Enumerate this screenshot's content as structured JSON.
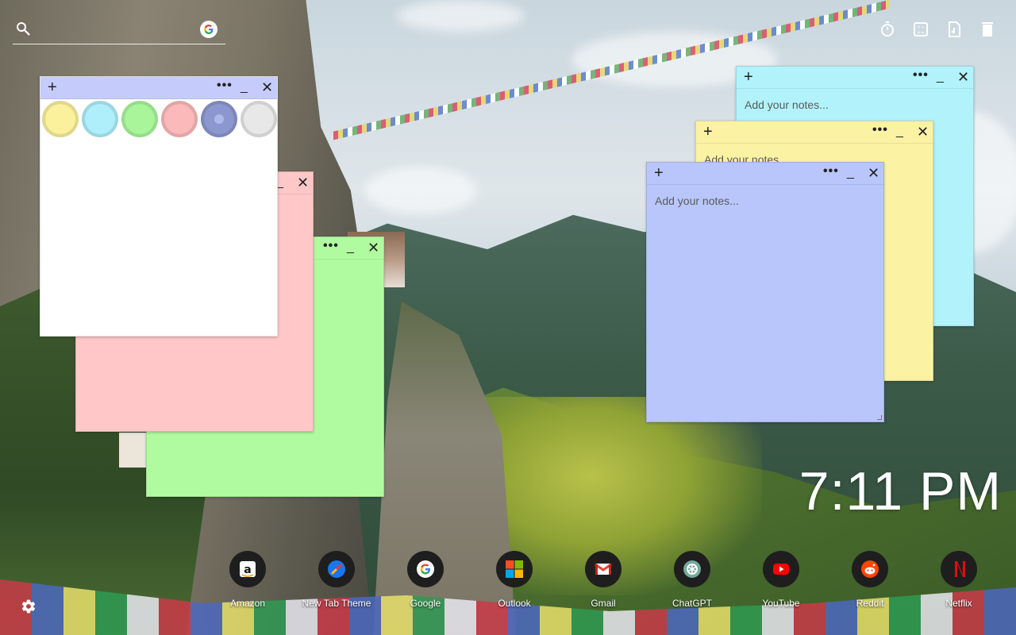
{
  "search": {
    "placeholder": ""
  },
  "top_icons": [
    {
      "name": "timer-icon"
    },
    {
      "name": "calculator-icon"
    },
    {
      "name": "notes-icon"
    },
    {
      "name": "trash-icon"
    }
  ],
  "notes": {
    "white": {
      "plus": "+",
      "more": "•••",
      "min": "_",
      "close": "✕",
      "color": "#ffffff"
    },
    "pink": {
      "more": "",
      "min": "_",
      "close": "✕",
      "color": "#ffc7c7"
    },
    "green": {
      "more": "•••",
      "min": "_",
      "close": "✕",
      "color": "#b0fb9f"
    },
    "cyan": {
      "plus": "+",
      "more": "•••",
      "min": "_",
      "close": "✕",
      "placeholder": "Add your notes...",
      "color": "#b2f2fb"
    },
    "yellow": {
      "plus": "+",
      "more": "•••",
      "min": "_",
      "close": "✕",
      "placeholder": "Add your notes...",
      "color": "#fbf2a4"
    },
    "blue": {
      "plus": "+",
      "more": "•••",
      "min": "_",
      "close": "✕",
      "placeholder": "Add your notes...",
      "color": "#b8c6fb"
    }
  },
  "swatches": [
    {
      "name": "yellow",
      "color": "#fbf09c"
    },
    {
      "name": "cyan",
      "color": "#aeeffb"
    },
    {
      "name": "green",
      "color": "#a9f59a"
    },
    {
      "name": "pink",
      "color": "#fbb9b9"
    },
    {
      "name": "blue",
      "color": "#8d97cf",
      "selected": true
    },
    {
      "name": "gray",
      "color": "#e8e8e8"
    }
  ],
  "clock": {
    "time": "7:11 PM"
  },
  "dock": [
    {
      "label": "Amazon",
      "icon": "amazon-icon"
    },
    {
      "label": "New Tab Theme",
      "icon": "new-tab-theme-icon"
    },
    {
      "label": "Google",
      "icon": "google-icon"
    },
    {
      "label": "Outlook",
      "icon": "outlook-icon"
    },
    {
      "label": "Gmail",
      "icon": "gmail-icon"
    },
    {
      "label": "ChatGPT",
      "icon": "chatgpt-icon"
    },
    {
      "label": "YouTube",
      "icon": "youtube-icon"
    },
    {
      "label": "Reddit",
      "icon": "reddit-icon"
    },
    {
      "label": "Netflix",
      "icon": "netflix-icon"
    }
  ]
}
